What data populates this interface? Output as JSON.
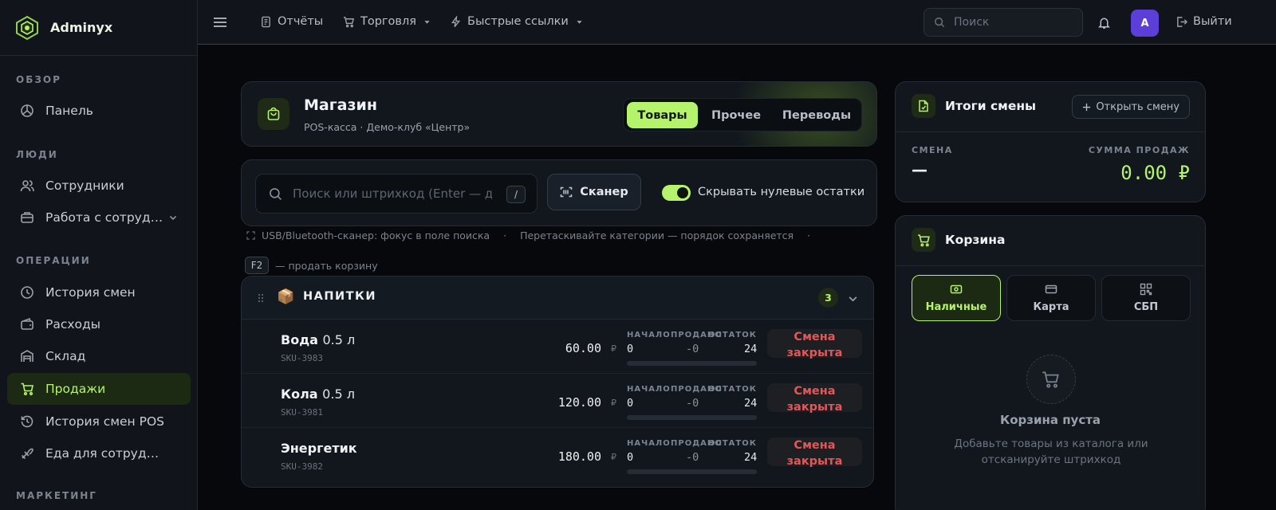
{
  "brand": {
    "name": "Adminyx"
  },
  "sidebar": {
    "sections": [
      {
        "label": "ОБЗОР"
      },
      {
        "label": "ЛЮДИ"
      },
      {
        "label": "ОПЕРАЦИИ"
      },
      {
        "label": "МАРКЕТИНГ"
      }
    ],
    "items": [
      {
        "label": "Панель",
        "icon": "dashboard-icon"
      },
      {
        "label": "Сотрудники",
        "icon": "users-icon"
      },
      {
        "label": "Работа с сотрудн…",
        "icon": "briefcase-icon"
      },
      {
        "label": "История смен",
        "icon": "clock-icon"
      },
      {
        "label": "Расходы",
        "icon": "wallet-icon"
      },
      {
        "label": "Склад",
        "icon": "warehouse-icon"
      },
      {
        "label": "Продажи",
        "icon": "cart-icon",
        "active": true
      },
      {
        "label": "История смен POS",
        "icon": "history-icon"
      },
      {
        "label": "Еда для сотрудников",
        "icon": "food-icon"
      }
    ]
  },
  "topbar": {
    "reports": "Отчёты",
    "trade": "Торговля",
    "quick_links": "Быстрые ссылки",
    "search_placeholder": "Поиск",
    "avatar_letter": "A",
    "logout": "Выйти"
  },
  "shop": {
    "title": "Магазин",
    "subtitle": "POS-касса · Демо-клуб «Центр»",
    "tabs": [
      "Товары",
      "Прочее",
      "Переводы"
    ],
    "active_tab": 0
  },
  "search": {
    "placeholder": "Поиск или штрихкод (Enter — добавить)",
    "shortcut": "/",
    "scanner_label": "Сканер",
    "hide_zero_label": "Скрывать нулевые остатки",
    "hide_zero_on": true
  },
  "hints": {
    "scanner": "USB/Bluetooth-сканер: фокус в поле поиска",
    "sep": "·",
    "categories": "Перетаскивайте категории — порядок сохраняется",
    "sep2": "·",
    "f2_key": "F2",
    "f2_text": "— продать корзину"
  },
  "category": {
    "emoji": "📦",
    "title": "НАПИТКИ",
    "count": "3",
    "stat_labels": {
      "start": "НАЧАЛО",
      "sold": "ПРОДАНО",
      "left": "ОСТАТОК"
    },
    "currency": "₽",
    "products": [
      {
        "name": "Вода",
        "size": "0.5 л",
        "sku": "SKU-3983",
        "price": "60.00",
        "start": "0",
        "sold": "-0",
        "left": "24",
        "progress": 0,
        "status": "Смена закрыта"
      },
      {
        "name": "Кола",
        "size": "0.5 л",
        "sku": "SKU-3981",
        "price": "120.00",
        "start": "0",
        "sold": "-0",
        "left": "24",
        "progress": 0,
        "status": "Смена закрыта"
      },
      {
        "name": "Энергетик",
        "size": "",
        "sku": "SKU-3982",
        "price": "180.00",
        "start": "0",
        "sold": "-0",
        "left": "24",
        "progress": 0,
        "status": "Смена закрыта"
      }
    ]
  },
  "shift": {
    "title": "Итоги смены",
    "open_button": "Открыть смену",
    "shift_label": "СМЕНА",
    "shift_value": "—",
    "sum_label": "СУММА ПРОДАЖ",
    "sum_value": "0.00 ₽"
  },
  "cart": {
    "title": "Корзина",
    "payment_methods": [
      "Наличные",
      "Карта",
      "СБП"
    ],
    "active_payment": 0,
    "empty_title": "Корзина пуста",
    "empty_text": "Добавьте товары из каталога или отсканируйте штрихкод"
  },
  "colors": {
    "accent": "#b6f36d",
    "danger": "#e0585a",
    "avatar": "#5b3fd8"
  }
}
